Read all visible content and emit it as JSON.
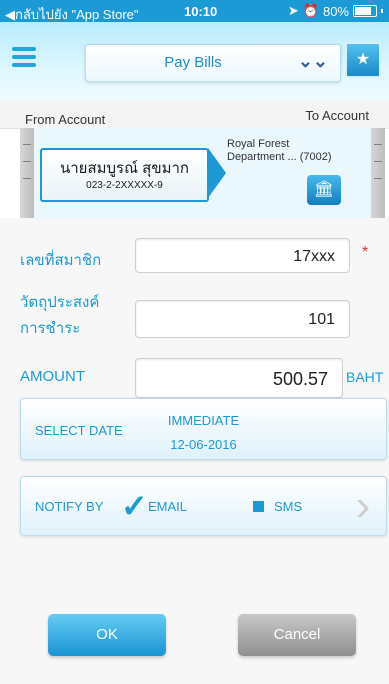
{
  "status_bar": {
    "back_text": "◀กลับไปยัง \"App Store\"",
    "time": "10:10",
    "battery": "80%"
  },
  "header": {
    "title": "Pay Bills",
    "selector_icon": "double-chevron-down-icon",
    "menu_icon": "hamburger-menu-icon",
    "bookmark_icon": "bookmark-star-icon"
  },
  "accounts": {
    "from_label": "From Account",
    "to_label": "To Account",
    "from_name": "นายสมบูรณ์ สุขมาก",
    "from_number": "023-2-2XXXXX-9",
    "to_line1": "Royal Forest",
    "to_line2": "Department ... (7002)",
    "bank_icon": "bank-building-icon"
  },
  "form": {
    "member_no_label": "เลขที่สมาชิก",
    "member_no_value": "17xxx",
    "required_mark": "*",
    "purpose_label_line1": "วัตถุประสงค์",
    "purpose_label_line2": "การชำระ",
    "purpose_value": "101",
    "amount_label": "AMOUNT",
    "amount_value": "500.57",
    "amount_unit": "BAHT"
  },
  "date_panel": {
    "label": "SELECT DATE",
    "value_top": "IMMEDIATE",
    "value_bottom": "12-06-2016"
  },
  "notify_panel": {
    "label": "NOTIFY BY",
    "email_label": "EMAIL",
    "sms_label": "SMS",
    "email_checked": true,
    "sms_checked": false,
    "arrow_icon": "chevron-right-icon"
  },
  "buttons": {
    "ok": "OK",
    "cancel": "Cancel"
  },
  "colors": {
    "accent": "#1b9ad6",
    "status_bar": "#1b9ad6",
    "required": "#e03535",
    "cancel": "#8f8f8f"
  }
}
